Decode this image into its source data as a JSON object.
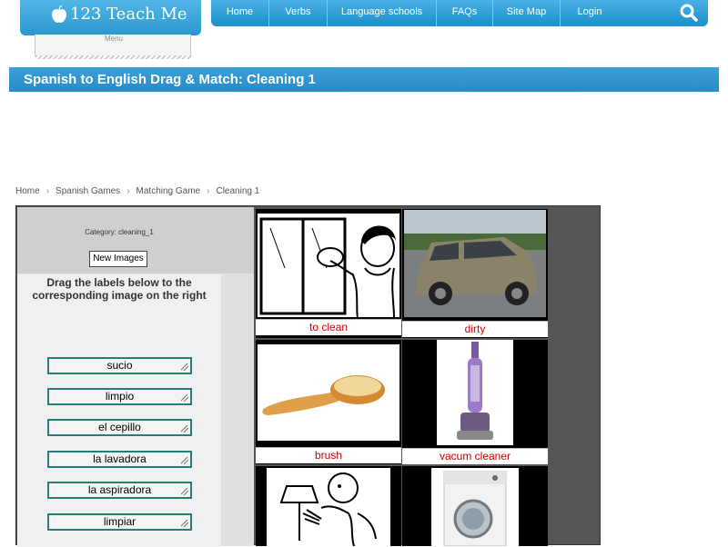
{
  "header": {
    "logo_text": "123 Teach Me",
    "menu_label": "Menu",
    "nav": [
      "Home",
      "Verbs",
      "Language schools",
      "FAQs",
      "Site Map",
      "Login"
    ],
    "search_icon": "search-icon"
  },
  "page": {
    "title": "Spanish to English Drag & Match: Cleaning 1"
  },
  "breadcrumb": [
    "Home",
    "Spanish Games",
    "Matching Game",
    "Cleaning 1"
  ],
  "game": {
    "category_label": "Category:",
    "category_value": "cleaning_1",
    "new_images_label": "New Images",
    "instructions": "Drag the labels below to the corresponding image on the right",
    "words": [
      "sucio",
      "limpio",
      "el cepillo",
      "la lavadora",
      "la aspiradora",
      "limpiar"
    ],
    "images": [
      {
        "caption": "to clean",
        "icon": "person-cleaning-window-drawing"
      },
      {
        "caption": "dirty",
        "icon": "dirty-suv-photo"
      },
      {
        "caption": "brush",
        "icon": "wooden-brush-photo"
      },
      {
        "caption": "vacum cleaner",
        "icon": "vacuum-cleaner-photo"
      },
      {
        "caption": "",
        "icon": "person-dusting-lamp-drawing"
      },
      {
        "caption": "",
        "icon": "washing-machine-photo"
      }
    ]
  },
  "colors": {
    "brand_blue": "#2a8ac5",
    "caption_red": "#cc0000",
    "label_border": "#2a7c7a"
  }
}
